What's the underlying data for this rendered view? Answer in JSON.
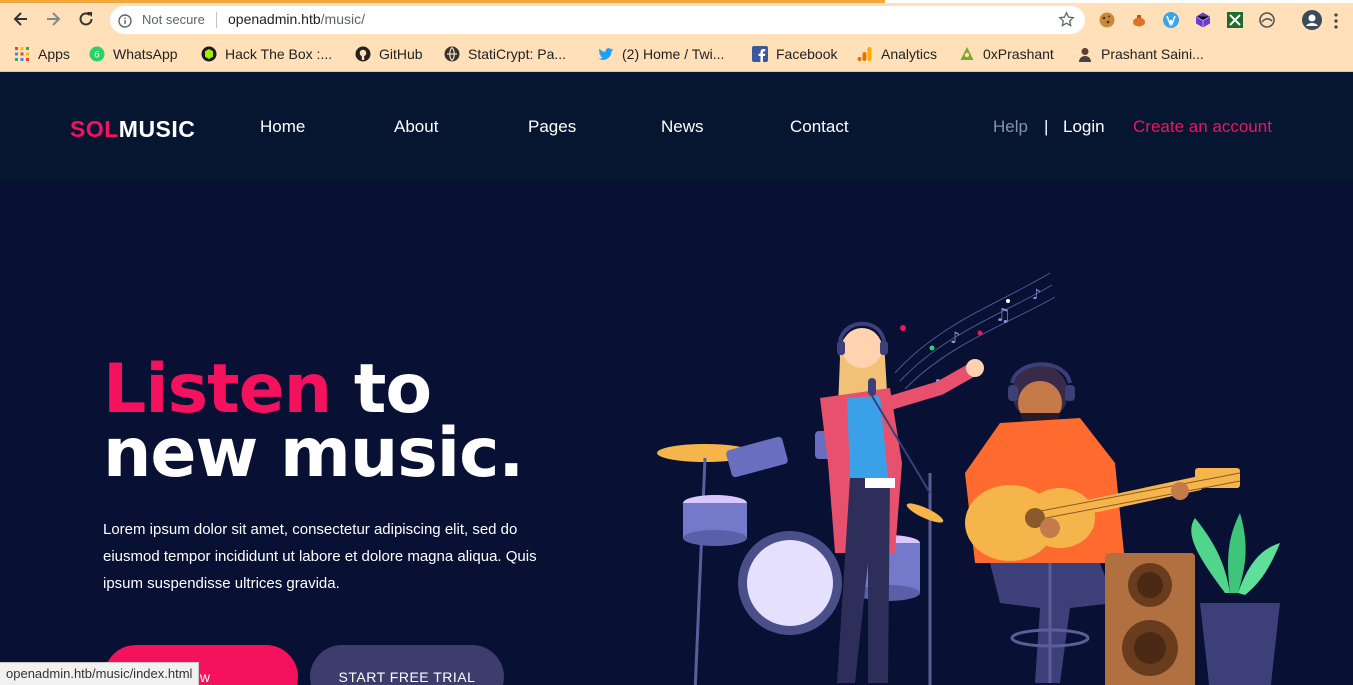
{
  "browser": {
    "security_label": "Not secure",
    "url_host": "openadmin.htb",
    "url_path": "/music/",
    "status_url": "openadmin.htb/music/index.html",
    "bookmarks": [
      {
        "label": "Apps",
        "icon": "apps-grid-icon"
      },
      {
        "label": "WhatsApp",
        "icon": "whatsapp-icon"
      },
      {
        "label": "Hack The Box :...",
        "icon": "hackthebox-icon"
      },
      {
        "label": "GitHub",
        "icon": "github-icon"
      },
      {
        "label": "StatiCrypt: Pa...",
        "icon": "staticrypt-icon"
      },
      {
        "label": "(2) Home / Twi...",
        "icon": "twitter-icon"
      },
      {
        "label": "Facebook",
        "icon": "facebook-icon"
      },
      {
        "label": "Analytics",
        "icon": "analytics-icon"
      },
      {
        "label": "0xPrashant",
        "icon": "0xprashant-icon"
      },
      {
        "label": "Prashant Saini...",
        "icon": "profile-icon"
      }
    ]
  },
  "site": {
    "logo_part1": "SOL",
    "logo_part2": "MUSIC",
    "nav": {
      "home": "Home",
      "about": "About",
      "pages": "Pages",
      "news": "News",
      "contact": "Contact"
    },
    "help": "Help",
    "separator": "|",
    "login": "Login",
    "create_account": "Create an account"
  },
  "hero": {
    "title_highlight": "Listen",
    "title_rest_line1": " to",
    "title_line2": "new music.",
    "lead": "Lorem ipsum dolor sit amet, consectetur adipiscing elit, sed do eiusmod tempor incididunt ut labore et dolore magna aliqua. Quis ipsum suspendisse ultrices gravida.",
    "primary_button": "ow",
    "secondary_button": "START FREE TRIAL"
  },
  "colors": {
    "accent": "#f4115e",
    "header_bg": "#061631",
    "hero_bg": "#081033",
    "secondary_button": "#3c3d6d",
    "browser_bar": "#ffe0b8"
  }
}
